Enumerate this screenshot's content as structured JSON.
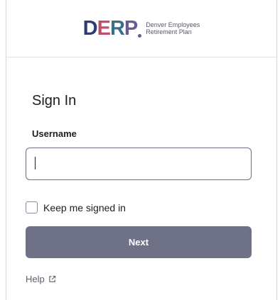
{
  "brand": {
    "logo_letters": "DERP",
    "name_line1": "Denver Employees",
    "name_line2": "Retirement Plan",
    "colors": {
      "d": "#2e3c73",
      "e": "#c24f6a",
      "r": "#3a6f8a",
      "p": "#6c5a93"
    }
  },
  "form": {
    "title": "Sign In",
    "username_label": "Username",
    "username_value": "",
    "remember_label": "Keep me signed in",
    "remember_checked": false,
    "next_label": "Next",
    "next_color": "#6f7287"
  },
  "footer": {
    "help_label": "Help",
    "help_icon": "external-link-icon"
  }
}
